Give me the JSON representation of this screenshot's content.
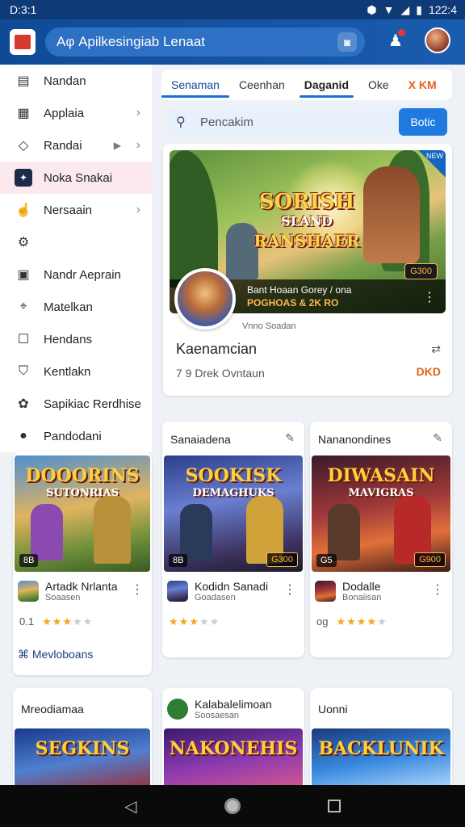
{
  "status": {
    "time": "D:3:1",
    "right": "122:4"
  },
  "appbar": {
    "title": "Aφ Apilkesingiab Lenaat"
  },
  "sidebar": {
    "items": [
      {
        "label": "Nandan",
        "icon": "list-icon",
        "glyph": "▤",
        "chev": false
      },
      {
        "label": "Applaia",
        "icon": "calendar-icon",
        "glyph": "▦",
        "chev": true
      },
      {
        "label": "Randai",
        "icon": "diamond-icon",
        "glyph": "◇",
        "chev": true
      },
      {
        "label": "Noka Snakai",
        "icon": "puzzle-icon",
        "glyph": "✦",
        "chev": false,
        "active": true
      },
      {
        "label": "Nersaain",
        "icon": "thumbs-up-icon",
        "glyph": "☝",
        "chev": true
      },
      {
        "label": "",
        "icon": "gear-icon",
        "glyph": "⚙",
        "chev": false
      },
      {
        "label": "Nandr Aeprain",
        "icon": "square-icon",
        "glyph": "▣",
        "chev": false
      },
      {
        "label": "Matelkan",
        "icon": "location-icon",
        "glyph": "⌖",
        "chev": false
      },
      {
        "label": "Hendans",
        "icon": "checkbox-icon",
        "glyph": "☐",
        "chev": false
      },
      {
        "label": "Kentlakn",
        "icon": "shield-icon",
        "glyph": "⛉",
        "chev": false
      },
      {
        "label": "Sapikiac Rerdhise",
        "icon": "cog-icon",
        "glyph": "✿",
        "chev": false
      },
      {
        "label": "Pandodani",
        "icon": "avatar-icon",
        "glyph": "●",
        "chev": false
      }
    ]
  },
  "tabs": [
    "Senaman",
    "Ceenhan",
    "Daganid",
    "Oke",
    "X KM"
  ],
  "search": {
    "placeholder": "Pencakim",
    "button": "Botic"
  },
  "featured": {
    "logo_l1": "SORISH",
    "logo_l2": "SLAND",
    "logo_l3": "RANSHAER",
    "corner": "NEW",
    "badge": "G300",
    "overlay_title": "Bant Hoaan Gorey / ona",
    "overlay_sub": "POGHOAS & 2K RO",
    "credit": "Vnno Soadan",
    "title": "Kaenamcian",
    "subtitle": "7 9 Drek Ovntaun",
    "tag": "DKD"
  },
  "cards": [
    {
      "header": "",
      "logo": "DOOORINS",
      "logo_sub": "SUTONRIAS",
      "count": "8B",
      "price": "",
      "app": "Artadk Nrlanta",
      "app_sub": "Soaasen",
      "rating": "0.1",
      "stars": 3,
      "more": "Mevloboans",
      "theme": "forest"
    },
    {
      "header": "Sanaiadena",
      "logo": "SOOKISK",
      "logo_sub": "DEMAGHUKS",
      "count": "8B",
      "price": "G300",
      "app": "Kodidn Sanadi",
      "app_sub": "Goadasen",
      "rating": "",
      "stars": 3,
      "more": "",
      "theme": "night"
    },
    {
      "header": "Nananondines",
      "logo": "DIWASAIN",
      "logo_sub": "MAVIGRAS",
      "count": "G5",
      "price": "G900",
      "app": "Dodalle",
      "app_sub": "Bonaiisan",
      "rating": "og",
      "stars": 4,
      "more": "",
      "theme": "fire"
    }
  ],
  "cards2": [
    {
      "header": "Mreodiamaa",
      "logo": "SEGKINS",
      "theme": "blue"
    },
    {
      "header": "Kalabalelimoan",
      "sub": "Soosaesan",
      "logo": "NAKONEHIS",
      "theme": "purple"
    },
    {
      "header": "Uonni",
      "logo": "BACKLUNIK",
      "theme": "ice"
    }
  ],
  "colors": {
    "accent": "#1a6fd6",
    "appbar": "#0f4a95",
    "tag": "#e0651a"
  }
}
